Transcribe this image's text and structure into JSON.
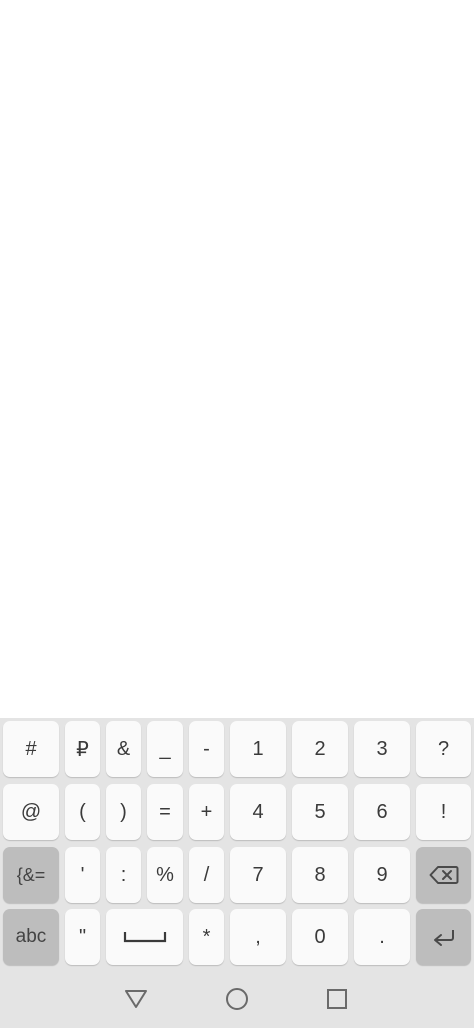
{
  "keyboard": {
    "rows": [
      [
        "#",
        "₽",
        "&",
        "_",
        "-",
        "1",
        "2",
        "3",
        "?"
      ],
      [
        "@",
        "(",
        ")",
        "=",
        "+",
        "4",
        "5",
        "6",
        "!"
      ],
      [
        "{&=",
        "'",
        ":",
        "%",
        "/",
        "7",
        "8",
        "9"
      ],
      [
        "abc",
        "\"",
        "*",
        ",",
        "0",
        "."
      ]
    ],
    "icons": {
      "backspace": "backspace-icon",
      "enter": "enter-icon",
      "space": "space-bar-icon"
    },
    "colors": {
      "key_bg": "#fafafa",
      "special_key_bg": "#bdbdbd",
      "keyboard_bg": "#e4e4e4",
      "key_text": "#3a3a3a"
    }
  },
  "navbar": {
    "icons": [
      "back-triangle-icon",
      "home-circle-icon",
      "recents-square-icon"
    ]
  }
}
